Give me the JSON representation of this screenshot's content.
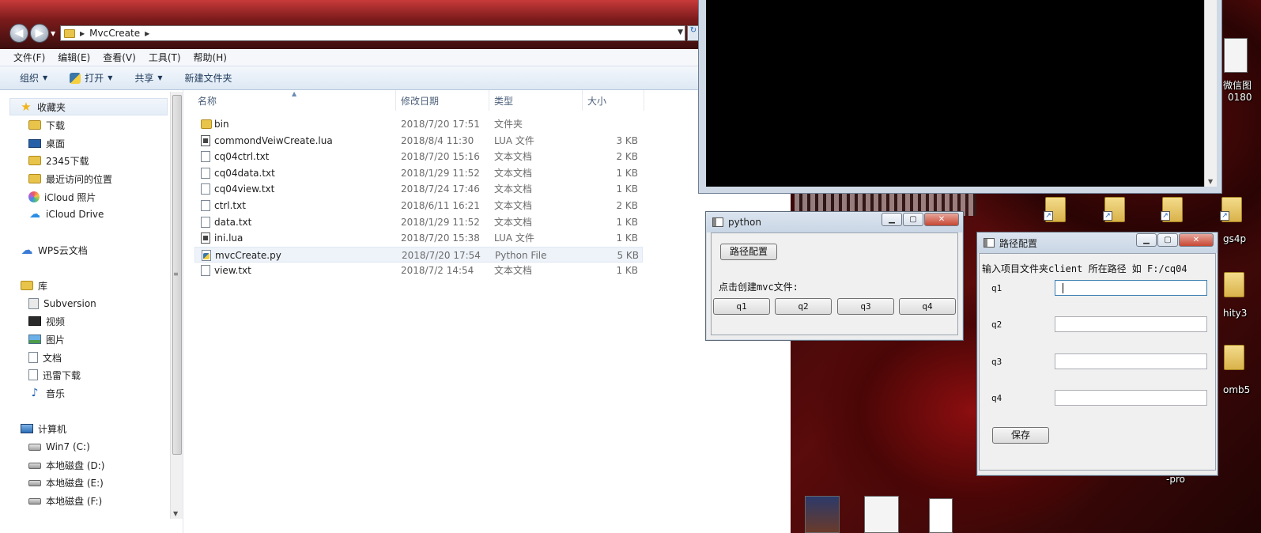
{
  "explorer": {
    "breadcrumb": "MvcCreate",
    "menu": [
      "文件(F)",
      "编辑(E)",
      "查看(V)",
      "工具(T)",
      "帮助(H)"
    ],
    "toolbar": {
      "organize": "组织",
      "open": "打开",
      "share": "共享",
      "new_folder": "新建文件夹"
    },
    "nav": {
      "favorites": "收藏夹",
      "downloads": "下载",
      "desktop": "桌面",
      "downloads_2345": "2345下载",
      "recent": "最近访问的位置",
      "icloud_photos": "iCloud 照片",
      "icloud_drive": "iCloud Drive",
      "wps_cloud": "WPS云文档",
      "libraries": "库",
      "subversion": "Subversion",
      "videos": "视频",
      "pictures": "图片",
      "documents": "文档",
      "xunlei": "迅雷下载",
      "music": "音乐",
      "computer": "计算机",
      "drive_c": "Win7 (C:)",
      "drive_d": "本地磁盘 (D:)",
      "drive_e": "本地磁盘 (E:)",
      "drive_f": "本地磁盘 (F:)"
    },
    "columns": {
      "name": "名称",
      "date": "修改日期",
      "type": "类型",
      "size": "大小"
    },
    "files": [
      {
        "name": "bin",
        "date": "2018/7/20 17:51",
        "type": "文件夹",
        "size": "",
        "icon": "folder-icon"
      },
      {
        "name": "commondVeiwCreate.lua",
        "date": "2018/8/4 11:30",
        "type": "LUA 文件",
        "size": "3 KB",
        "icon": "lua-file-icon"
      },
      {
        "name": "cq04ctrl.txt",
        "date": "2018/7/20 15:16",
        "type": "文本文档",
        "size": "2 KB",
        "icon": "text-file-icon"
      },
      {
        "name": "cq04data.txt",
        "date": "2018/1/29 11:52",
        "type": "文本文档",
        "size": "1 KB",
        "icon": "text-file-icon"
      },
      {
        "name": "cq04view.txt",
        "date": "2018/7/24 17:46",
        "type": "文本文档",
        "size": "1 KB",
        "icon": "text-file-icon"
      },
      {
        "name": "ctrl.txt",
        "date": "2018/6/11 16:21",
        "type": "文本文档",
        "size": "2 KB",
        "icon": "text-file-icon"
      },
      {
        "name": "data.txt",
        "date": "2018/1/29 11:52",
        "type": "文本文档",
        "size": "1 KB",
        "icon": "text-file-icon"
      },
      {
        "name": "ini.lua",
        "date": "2018/7/20 15:38",
        "type": "LUA 文件",
        "size": "1 KB",
        "icon": "lua-file-icon"
      },
      {
        "name": "mvcCreate.py",
        "date": "2018/7/20 17:54",
        "type": "Python File",
        "size": "5 KB",
        "icon": "python-file-icon"
      },
      {
        "name": "view.txt",
        "date": "2018/7/2 14:54",
        "type": "文本文档",
        "size": "1 KB",
        "icon": "text-file-icon"
      }
    ]
  },
  "python_window": {
    "title": "python",
    "path_config_button": "路径配置",
    "prompt": "点击创建mvc文件:",
    "buttons": [
      "q1",
      "q2",
      "q3",
      "q4"
    ]
  },
  "path_window": {
    "title": "路径配置",
    "instruction": "输入项目文件夹client 所在路径 如 F:/cq04",
    "fields": [
      {
        "label": "q1",
        "value": ""
      },
      {
        "label": "q2",
        "value": ""
      },
      {
        "label": "q3",
        "value": ""
      },
      {
        "label": "q4",
        "value": ""
      }
    ],
    "save_button": "保存"
  },
  "desktop": {
    "labels": {
      "wechat": "微信图",
      "wechat_num": "0180",
      "gs4p": "gs4p",
      "unity": "hity3",
      "zomb": "omb5",
      "pro": "-pro"
    }
  },
  "colors": {
    "selection": "#eef3fa",
    "explorer_header_text": "#1e395b",
    "close_button": "#c74733"
  }
}
